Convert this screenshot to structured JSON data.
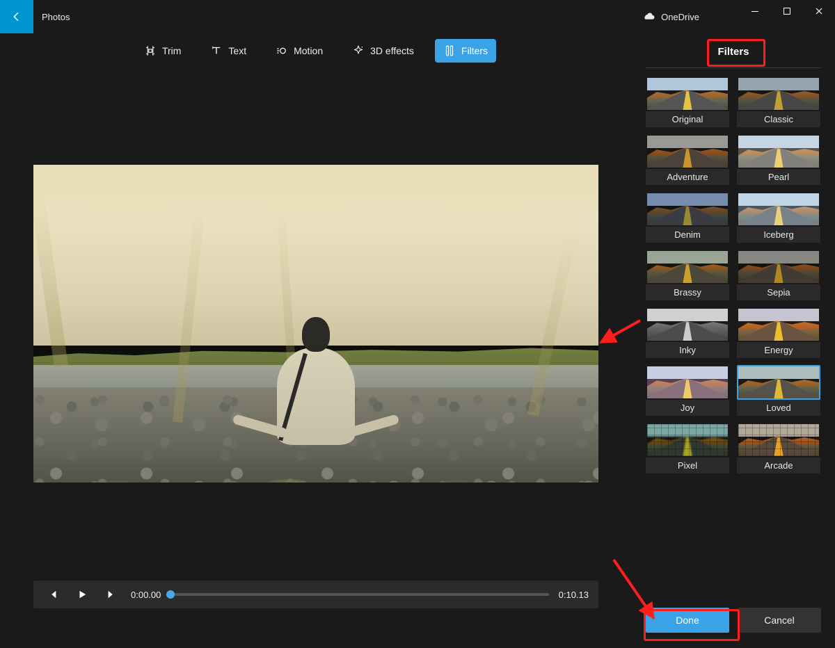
{
  "app": {
    "title": "Photos"
  },
  "onedrive": {
    "label": "OneDrive"
  },
  "toolbar": {
    "items": [
      {
        "id": "trim",
        "label": "Trim"
      },
      {
        "id": "text",
        "label": "Text"
      },
      {
        "id": "motion",
        "label": "Motion"
      },
      {
        "id": "3deffects",
        "label": "3D effects"
      },
      {
        "id": "filters",
        "label": "Filters"
      }
    ],
    "active": "filters"
  },
  "playback": {
    "current_time": "0:00.00",
    "total_time": "0:10.13",
    "progress": 0
  },
  "panel": {
    "title": "Filters",
    "filters": [
      {
        "id": "original",
        "label": "Original"
      },
      {
        "id": "classic",
        "label": "Classic"
      },
      {
        "id": "adventure",
        "label": "Adventure"
      },
      {
        "id": "pearl",
        "label": "Pearl"
      },
      {
        "id": "denim",
        "label": "Denim"
      },
      {
        "id": "iceberg",
        "label": "Iceberg"
      },
      {
        "id": "brassy",
        "label": "Brassy"
      },
      {
        "id": "sepia",
        "label": "Sepia"
      },
      {
        "id": "inky",
        "label": "Inky"
      },
      {
        "id": "energy",
        "label": "Energy"
      },
      {
        "id": "joy",
        "label": "Joy"
      },
      {
        "id": "loved",
        "label": "Loved"
      },
      {
        "id": "pixel",
        "label": "Pixel"
      },
      {
        "id": "arcade",
        "label": "Arcade"
      }
    ],
    "selected_filter": "loved",
    "done_label": "Done",
    "cancel_label": "Cancel"
  },
  "annotations": {
    "box_filters_header": true,
    "box_done_button": true,
    "arrow_to_panel": true,
    "arrow_to_done": true
  }
}
